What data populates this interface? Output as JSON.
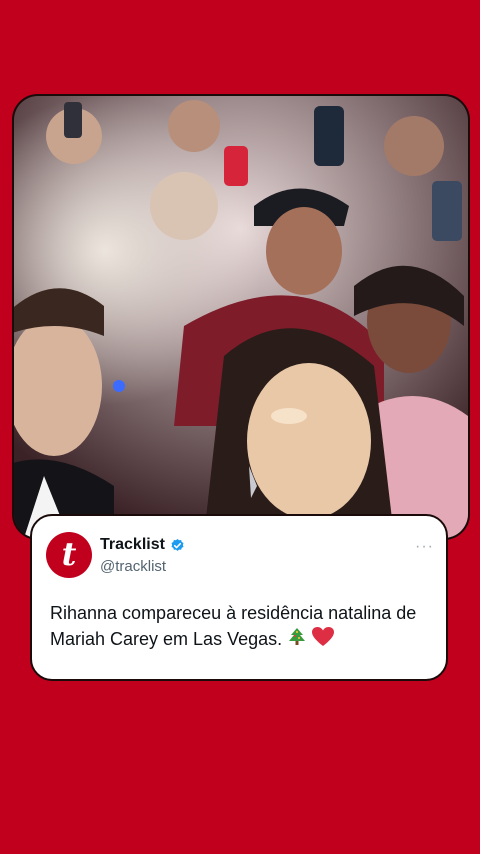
{
  "tweet": {
    "display_name": "Tracklist",
    "handle": "@tracklist",
    "avatar_letter": "t",
    "text": "Rihanna compareceu à residência natalina de Mariah Carey em Las Vegas.",
    "emojis": [
      "christmas-tree",
      "red-heart"
    ],
    "verified": true,
    "more_label": "···"
  },
  "colors": {
    "background": "#c1001e",
    "card": "#ffffff",
    "verified_blue": "#1d9bf0"
  }
}
